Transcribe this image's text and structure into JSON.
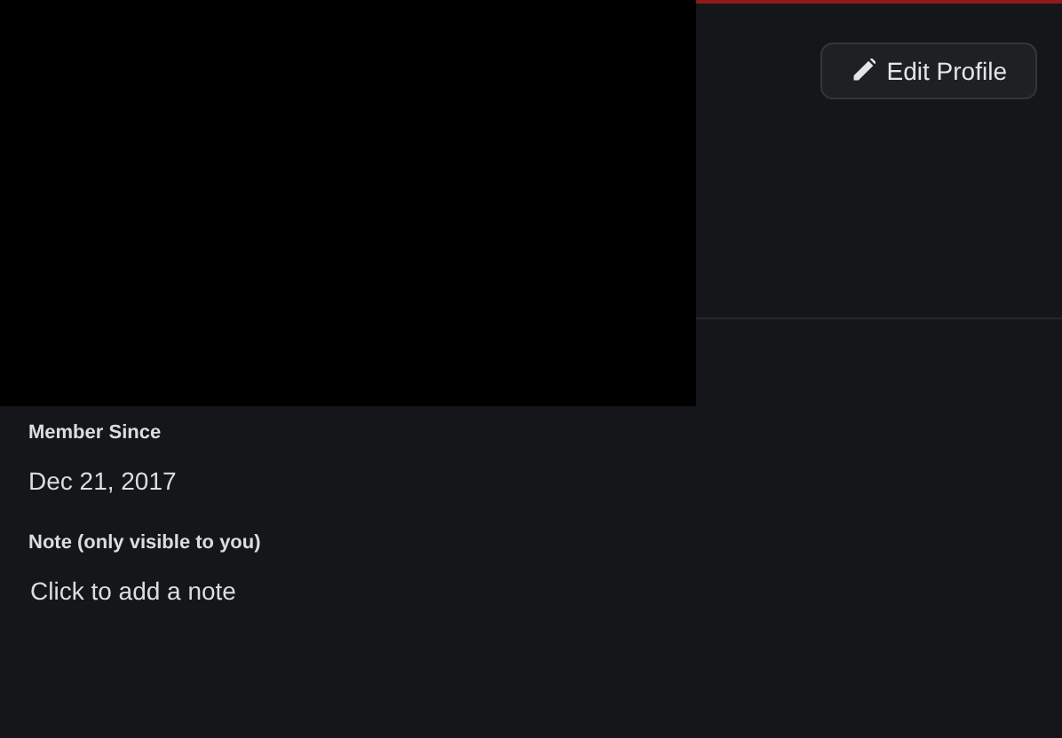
{
  "header": {
    "edit_button": "Edit Profile"
  },
  "sections": [
    {
      "title": "Member Since",
      "kind": "text",
      "value": "Dec 21, 2017"
    },
    {
      "title": "Note (only visible to you)",
      "kind": "note",
      "placeholder": "Click to add a note"
    }
  ]
}
